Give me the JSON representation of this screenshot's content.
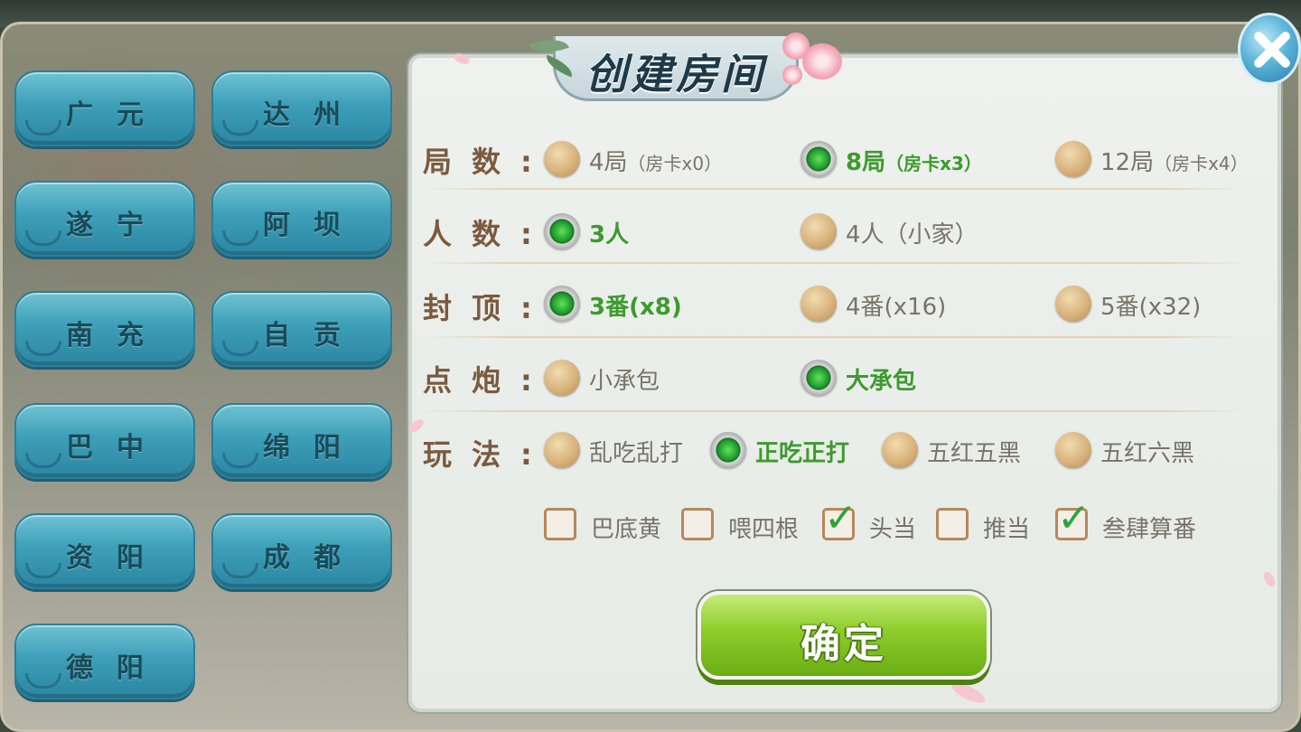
{
  "title": "创建房间",
  "cities": [
    "广元",
    "达州",
    "遂宁",
    "阿坝",
    "南充",
    "自贡",
    "巴中",
    "绵阳",
    "资阳",
    "成都",
    "德阳"
  ],
  "rows": {
    "rounds": {
      "label": "局数",
      "options": [
        {
          "main": "4局",
          "sub": "（房卡x0）",
          "selected": false
        },
        {
          "main": "8局",
          "sub": "（房卡x3）",
          "selected": true
        },
        {
          "main": "12局",
          "sub": "（房卡x4）",
          "selected": false
        }
      ]
    },
    "players": {
      "label": "人数",
      "options": [
        {
          "main": "3人",
          "selected": true
        },
        {
          "main": "4人（小家）",
          "selected": false
        }
      ]
    },
    "cap": {
      "label": "封顶",
      "options": [
        {
          "main": "3番(x8)",
          "selected": true
        },
        {
          "main": "4番(x16)",
          "selected": false
        },
        {
          "main": "5番(x32)",
          "selected": false
        }
      ]
    },
    "pao": {
      "label": "点炮",
      "options": [
        {
          "main": "小承包",
          "selected": false
        },
        {
          "main": "大承包",
          "selected": true
        }
      ]
    },
    "mode": {
      "label": "玩法",
      "options": [
        {
          "main": "乱吃乱打",
          "selected": false
        },
        {
          "main": "正吃正打",
          "selected": true
        },
        {
          "main": "五红五黑",
          "selected": false
        },
        {
          "main": "五红六黑",
          "selected": false
        }
      ]
    }
  },
  "checkboxes": [
    {
      "label": "巴底黄",
      "checked": false
    },
    {
      "label": "喂四根",
      "checked": false
    },
    {
      "label": "头当",
      "checked": true
    },
    {
      "label": "推当",
      "checked": false
    },
    {
      "label": "叁肆算番",
      "checked": true
    }
  ],
  "confirm_label": "确定",
  "colors": {
    "selected_text": "#3d9a2e",
    "label": "#7b5a3e",
    "city_button": "#3d9fb8",
    "confirm": "#8dcc29"
  },
  "icons": {
    "close": "close-icon",
    "radio": "radio-icon",
    "check": "checkmark-icon"
  }
}
